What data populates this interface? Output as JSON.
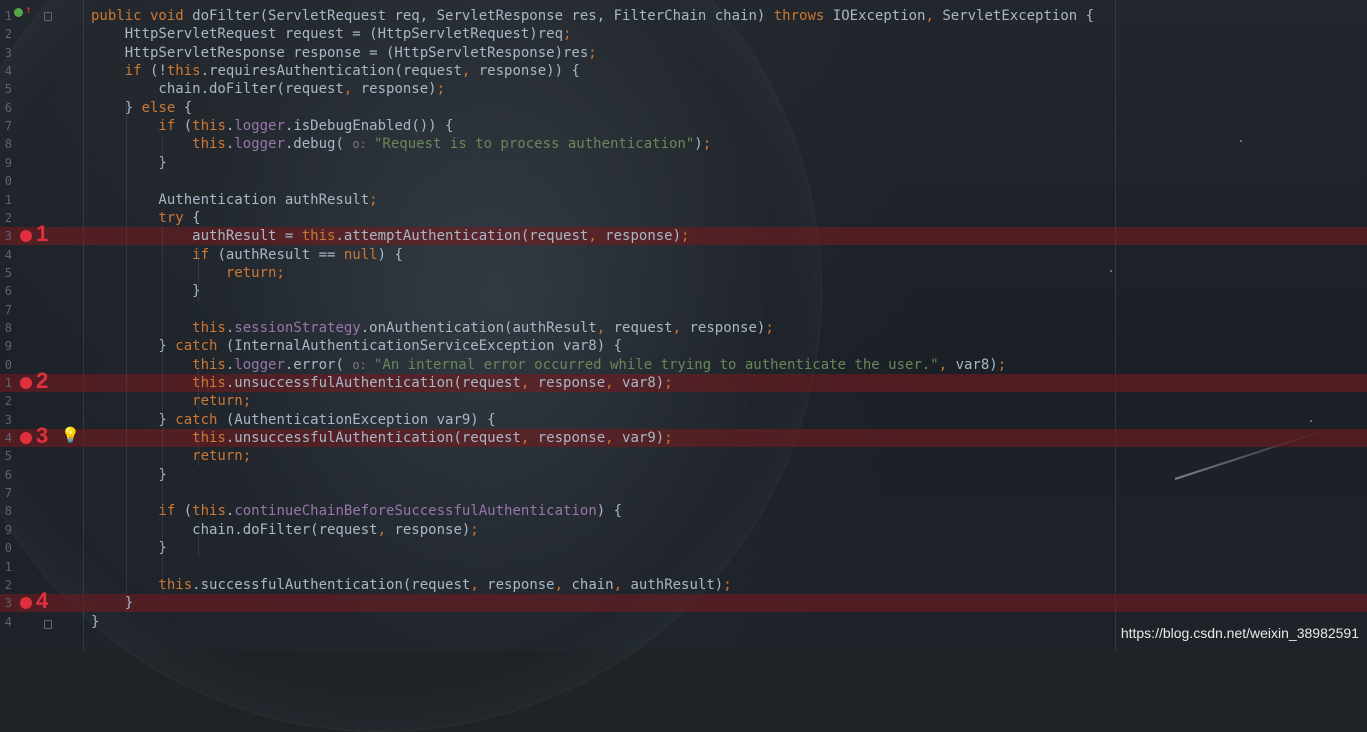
{
  "editor": {
    "lines": [
      {
        "num": "1",
        "segments": [
          [
            "k",
            "public void "
          ],
          [
            "pl",
            "doFilter(ServletRequest req, ServletResponse res, FilterChain chain) "
          ],
          [
            "k",
            "throws "
          ],
          [
            "pl",
            "IOException"
          ],
          [
            "k",
            ", "
          ],
          [
            "pl",
            "ServletException {"
          ]
        ]
      },
      {
        "num": "2",
        "segments": [
          [
            "pl",
            "    HttpServletRequest request = (HttpServletRequest)req"
          ],
          [
            "k",
            ";"
          ]
        ]
      },
      {
        "num": "3",
        "segments": [
          [
            "pl",
            "    HttpServletResponse response = (HttpServletResponse)res"
          ],
          [
            "k",
            ";"
          ]
        ]
      },
      {
        "num": "4",
        "segments": [
          [
            "k",
            "    if "
          ],
          [
            "pl",
            "(!"
          ],
          [
            "k",
            "this"
          ],
          [
            "pl",
            ".requiresAuthentication(request"
          ],
          [
            "k",
            ", "
          ],
          [
            "pl",
            "response)) {"
          ]
        ]
      },
      {
        "num": "5",
        "segments": [
          [
            "pl",
            "        chain.doFilter(request"
          ],
          [
            "k",
            ", "
          ],
          [
            "pl",
            "response)"
          ],
          [
            "k",
            ";"
          ]
        ]
      },
      {
        "num": "6",
        "segments": [
          [
            "pl",
            "    } "
          ],
          [
            "k",
            "else "
          ],
          [
            "pl",
            "{"
          ]
        ]
      },
      {
        "num": "7",
        "segments": [
          [
            "k",
            "        if "
          ],
          [
            "pl",
            "("
          ],
          [
            "k",
            "this"
          ],
          [
            "pl",
            "."
          ],
          [
            "fld",
            "logger"
          ],
          [
            "pl",
            ".isDebugEnabled()) {"
          ]
        ]
      },
      {
        "num": "8",
        "segments": [
          [
            "k",
            "            this"
          ],
          [
            "pl",
            "."
          ],
          [
            "fld",
            "logger"
          ],
          [
            "pl",
            ".debug( "
          ],
          [
            "hint",
            "o: "
          ],
          [
            "str",
            "\"Request is to process authentication\""
          ],
          [
            "pl",
            ")"
          ],
          [
            "k",
            ";"
          ]
        ]
      },
      {
        "num": "9",
        "segments": [
          [
            "pl",
            "        }"
          ]
        ]
      },
      {
        "num": "0",
        "segments": [
          [
            "pl",
            ""
          ]
        ]
      },
      {
        "num": "1",
        "segments": [
          [
            "pl",
            "        Authentication authResult"
          ],
          [
            "k",
            ";"
          ]
        ]
      },
      {
        "num": "2",
        "segments": [
          [
            "k",
            "        try "
          ],
          [
            "pl",
            "{"
          ]
        ]
      },
      {
        "num": "3",
        "segments": [
          [
            "pl",
            "            authResult = "
          ],
          [
            "k",
            "this"
          ],
          [
            "pl",
            ".attemptAuthentication(request"
          ],
          [
            "k",
            ", "
          ],
          [
            "pl",
            "response)"
          ],
          [
            "k",
            ";"
          ]
        ]
      },
      {
        "num": "4",
        "segments": [
          [
            "k",
            "            if "
          ],
          [
            "pl",
            "(authResult == "
          ],
          [
            "k",
            "null"
          ],
          [
            "pl",
            ") {"
          ]
        ]
      },
      {
        "num": "5",
        "segments": [
          [
            "k",
            "                return;"
          ]
        ]
      },
      {
        "num": "6",
        "segments": [
          [
            "pl",
            "            }"
          ]
        ]
      },
      {
        "num": "7",
        "segments": [
          [
            "pl",
            ""
          ]
        ]
      },
      {
        "num": "8",
        "segments": [
          [
            "k",
            "            this"
          ],
          [
            "pl",
            "."
          ],
          [
            "fld",
            "sessionStrategy"
          ],
          [
            "pl",
            ".onAuthentication(authResult"
          ],
          [
            "k",
            ", "
          ],
          [
            "pl",
            "request"
          ],
          [
            "k",
            ", "
          ],
          [
            "pl",
            "response)"
          ],
          [
            "k",
            ";"
          ]
        ]
      },
      {
        "num": "9",
        "segments": [
          [
            "pl",
            "        } "
          ],
          [
            "k",
            "catch "
          ],
          [
            "pl",
            "(InternalAuthenticationServiceException var8) {"
          ]
        ]
      },
      {
        "num": "0",
        "segments": [
          [
            "k",
            "            this"
          ],
          [
            "pl",
            "."
          ],
          [
            "fld",
            "logger"
          ],
          [
            "pl",
            ".error( "
          ],
          [
            "hint",
            "o: "
          ],
          [
            "str",
            "\"An internal error occurred while trying to authenticate the user.\""
          ],
          [
            "k",
            ", "
          ],
          [
            "pl",
            "var8)"
          ],
          [
            "k",
            ";"
          ]
        ]
      },
      {
        "num": "1",
        "segments": [
          [
            "k",
            "            this"
          ],
          [
            "pl",
            ".unsuccessfulAuthentication(request"
          ],
          [
            "k",
            ", "
          ],
          [
            "pl",
            "response"
          ],
          [
            "k",
            ", "
          ],
          [
            "pl",
            "var8)"
          ],
          [
            "k",
            ";"
          ]
        ]
      },
      {
        "num": "2",
        "segments": [
          [
            "k",
            "            return;"
          ]
        ]
      },
      {
        "num": "3",
        "segments": [
          [
            "pl",
            "        } "
          ],
          [
            "k",
            "catch "
          ],
          [
            "pl",
            "(AuthenticationException var9) {"
          ]
        ]
      },
      {
        "num": "4",
        "segments": [
          [
            "k",
            "            this"
          ],
          [
            "pl",
            ".unsuccessfulAuthentication(request"
          ],
          [
            "k",
            ", "
          ],
          [
            "pl",
            "response"
          ],
          [
            "k",
            ", "
          ],
          [
            "pl",
            "var9)"
          ],
          [
            "k",
            ";"
          ]
        ]
      },
      {
        "num": "5",
        "segments": [
          [
            "k",
            "            return;"
          ]
        ]
      },
      {
        "num": "6",
        "segments": [
          [
            "pl",
            "        }"
          ]
        ]
      },
      {
        "num": "7",
        "segments": [
          [
            "pl",
            ""
          ]
        ]
      },
      {
        "num": "8",
        "segments": [
          [
            "k",
            "        if "
          ],
          [
            "pl",
            "("
          ],
          [
            "k",
            "this"
          ],
          [
            "pl",
            "."
          ],
          [
            "fld",
            "continueChainBeforeSuccessfulAuthentication"
          ],
          [
            "pl",
            ") {"
          ]
        ]
      },
      {
        "num": "9",
        "segments": [
          [
            "pl",
            "            chain.doFilter(request"
          ],
          [
            "k",
            ", "
          ],
          [
            "pl",
            "response)"
          ],
          [
            "k",
            ";"
          ]
        ]
      },
      {
        "num": "0",
        "segments": [
          [
            "pl",
            "        }"
          ]
        ]
      },
      {
        "num": "1",
        "segments": [
          [
            "pl",
            ""
          ]
        ]
      },
      {
        "num": "2",
        "segments": [
          [
            "k",
            "        this"
          ],
          [
            "pl",
            ".successfulAuthentication(request"
          ],
          [
            "k",
            ", "
          ],
          [
            "pl",
            "response"
          ],
          [
            "k",
            ", "
          ],
          [
            "pl",
            "chain"
          ],
          [
            "k",
            ", "
          ],
          [
            "pl",
            "authResult)"
          ],
          [
            "k",
            ";"
          ]
        ]
      },
      {
        "num": "3",
        "segments": [
          [
            "pl",
            "    }"
          ]
        ]
      },
      {
        "num": "4",
        "segments": [
          [
            "pl",
            "}"
          ]
        ]
      }
    ],
    "breakpoints": [
      {
        "line_index": 12,
        "label": "1"
      },
      {
        "line_index": 20,
        "label": "2"
      },
      {
        "line_index": 23,
        "label": "3"
      },
      {
        "line_index": 32,
        "label": "4"
      }
    ]
  },
  "icons": {
    "override": "override-method-icon",
    "lightbulb": "intention-bulb-icon",
    "fold": "fold-icon"
  },
  "colors": {
    "keyword": "#cc7832",
    "string": "#6a8759",
    "field": "#9876aa",
    "breakpoint": "#e0303d"
  },
  "watermark": "https://blog.csdn.net/weixin_38982591"
}
